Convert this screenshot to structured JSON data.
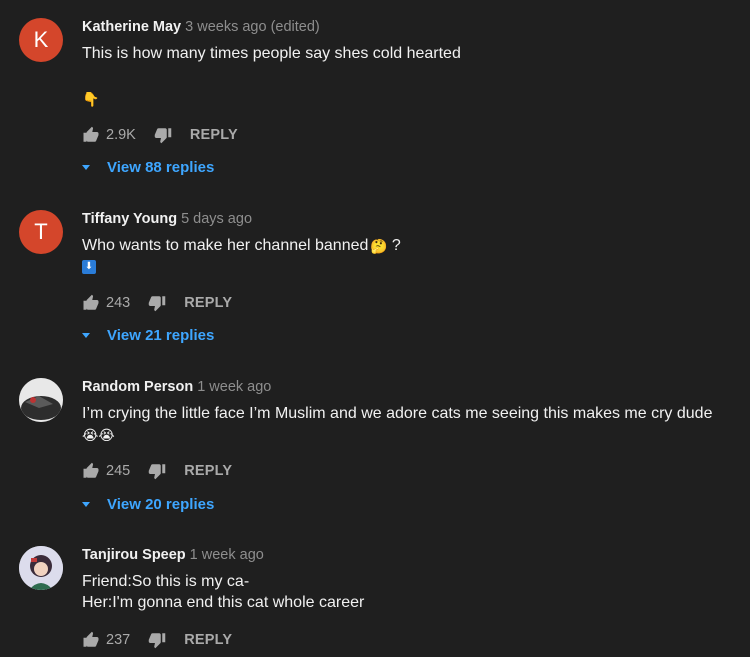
{
  "comments": [
    {
      "author": "Katherine May",
      "time": "3 weeks ago (edited)",
      "avatar_letter": "K",
      "lines": [
        "This is how many times people say shes cold hearted"
      ],
      "extra_emoji": "👇",
      "likes": "2.9K",
      "reply_label": "REPLY",
      "view_replies": "View 88 replies"
    },
    {
      "author": "Tiffany Young",
      "time": "5 days ago",
      "avatar_letter": "T",
      "lines": [
        "Who wants to make her channel banned"
      ],
      "line_suffix": "?",
      "inline_emoji": "🤔",
      "extra_emoji": "⬇",
      "likes": "243",
      "reply_label": "REPLY",
      "view_replies": "View 21 replies"
    },
    {
      "author": "Random Person",
      "time": "1 week ago",
      "lines": [
        "I’m crying the little face I’m Muslim and we adore cats me seeing this makes me cry dude"
      ],
      "extra_emoji": "😭😭",
      "likes": "245",
      "reply_label": "REPLY",
      "view_replies": "View 20 replies"
    },
    {
      "author": "Tanjirou Speep",
      "time": "1 week ago",
      "lines": [
        "Friend:So this is my ca-",
        "Her:I'm gonna end this cat whole career"
      ],
      "likes": "237",
      "reply_label": "REPLY"
    }
  ],
  "colors": {
    "background": "#1f1f1f",
    "avatar_letter_bg": "#d4462b",
    "link_blue": "#3ea6ff",
    "muted": "#aaaaaa"
  },
  "icons": {
    "like": "thumbs-up-icon",
    "dislike": "thumbs-down-icon",
    "expand": "caret-down-icon"
  }
}
